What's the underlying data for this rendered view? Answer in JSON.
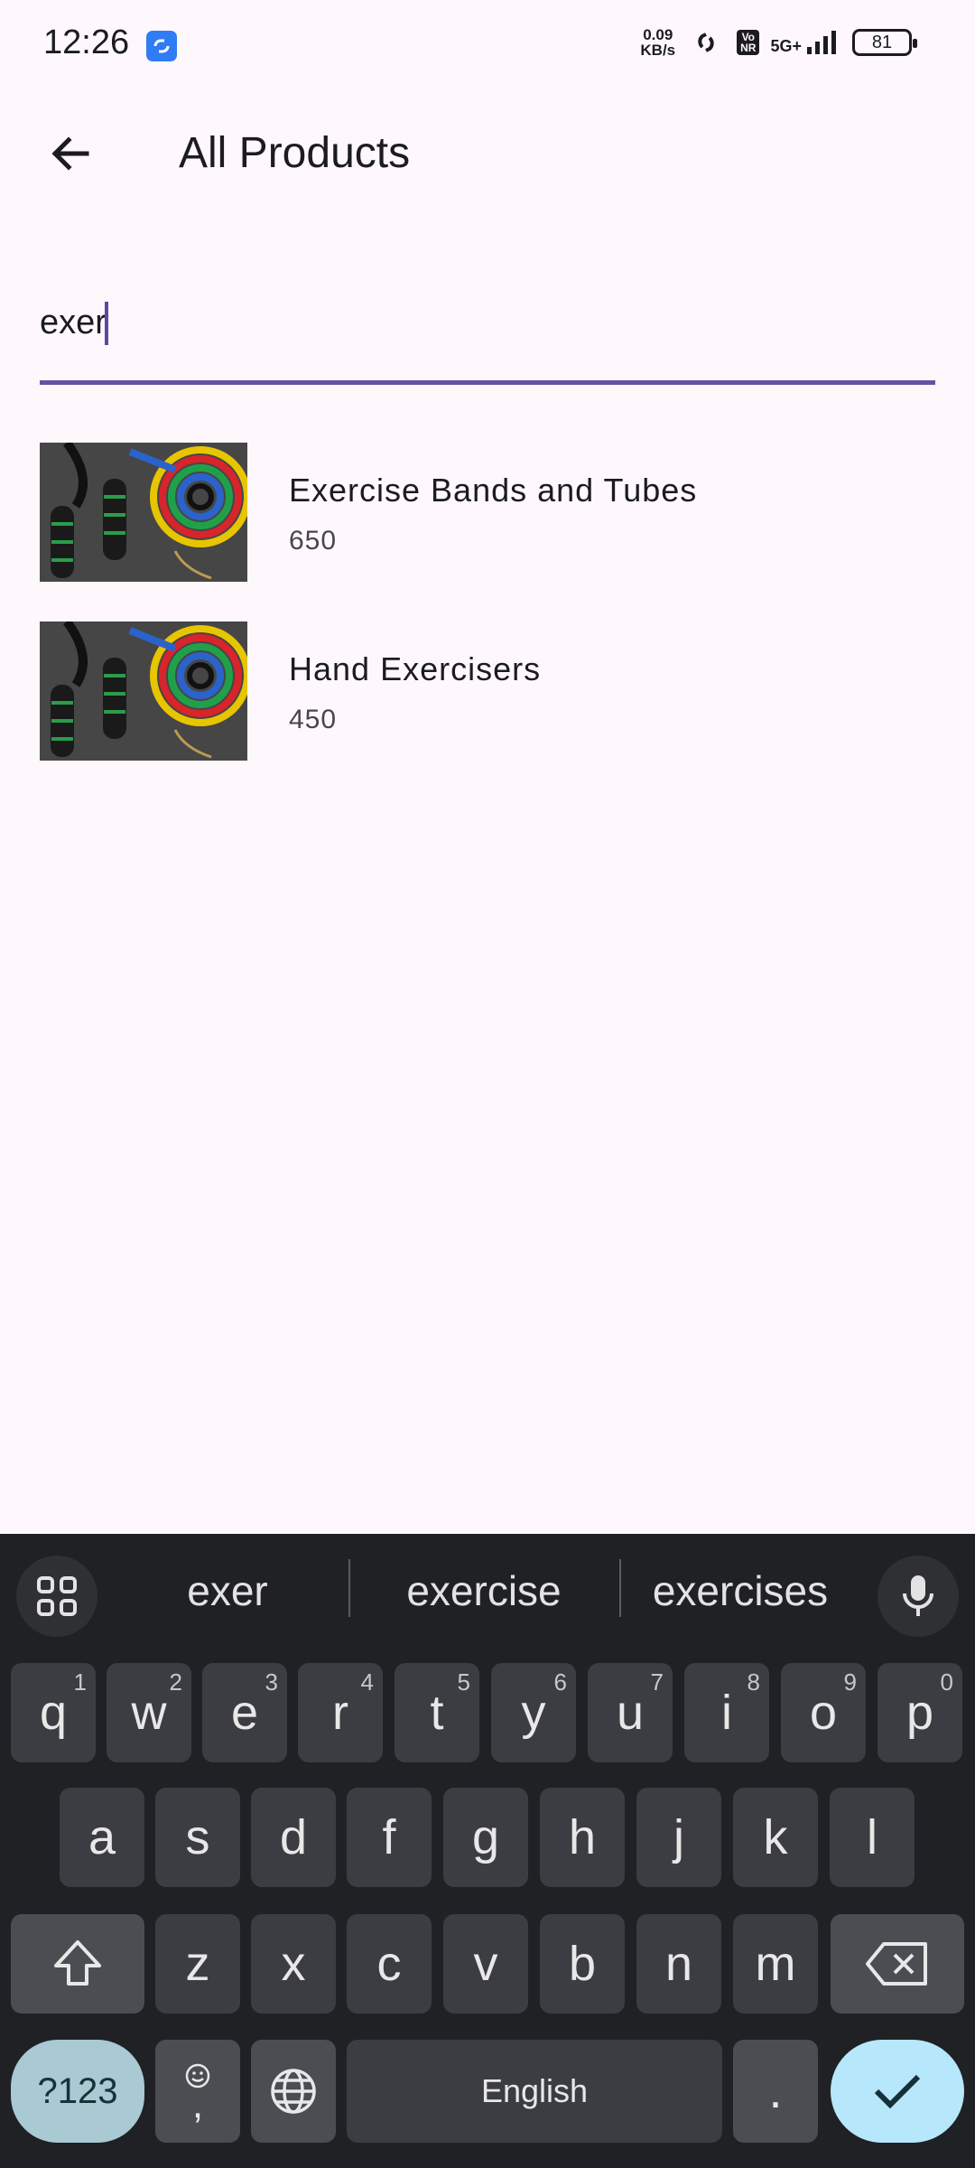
{
  "status": {
    "time": "12:26",
    "net_speed_value": "0.09",
    "net_speed_unit": "KB/s",
    "volte_top": "Vo",
    "volte_bottom": "NR",
    "network": "5G+",
    "battery": "81"
  },
  "appbar": {
    "title": "All Products"
  },
  "search": {
    "value": "exer"
  },
  "products": [
    {
      "name": "Exercise Bands and Tubes",
      "price": "650"
    },
    {
      "name": "Hand Exercisers",
      "price": "450"
    }
  ],
  "keyboard": {
    "suggestions": [
      "exer",
      "exercise",
      "exercises"
    ],
    "row1": [
      {
        "k": "q",
        "h": "1"
      },
      {
        "k": "w",
        "h": "2"
      },
      {
        "k": "e",
        "h": "3"
      },
      {
        "k": "r",
        "h": "4"
      },
      {
        "k": "t",
        "h": "5"
      },
      {
        "k": "y",
        "h": "6"
      },
      {
        "k": "u",
        "h": "7"
      },
      {
        "k": "i",
        "h": "8"
      },
      {
        "k": "o",
        "h": "9"
      },
      {
        "k": "p",
        "h": "0"
      }
    ],
    "row2": [
      "a",
      "s",
      "d",
      "f",
      "g",
      "h",
      "j",
      "k",
      "l"
    ],
    "row3": [
      "z",
      "x",
      "c",
      "v",
      "b",
      "n",
      "m"
    ],
    "symbols_label": "?123",
    "comma_label": ",",
    "space_label": "English",
    "period_label": "."
  },
  "colors": {
    "accent": "#6750a4",
    "background": "#fef8fc",
    "keyboard_bg": "#1f2125",
    "enter_key": "#b7e7fb"
  }
}
